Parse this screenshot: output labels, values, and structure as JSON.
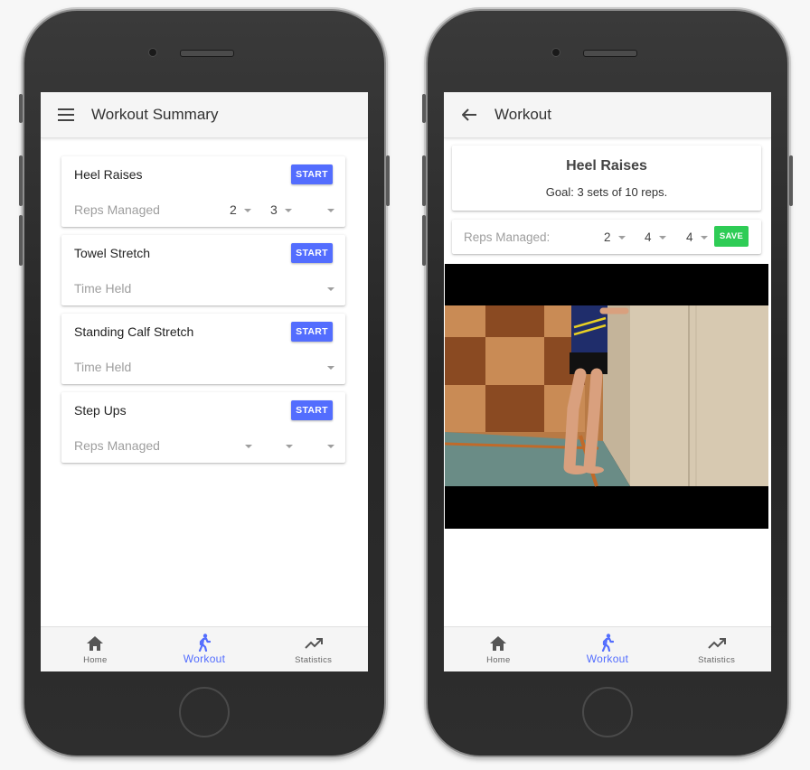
{
  "left_phone": {
    "appbar": {
      "title": "Workout Summary",
      "menu_icon": "menu-icon"
    },
    "exercises": [
      {
        "name": "Heel Raises",
        "button": "START",
        "measure": "Reps Managed",
        "values": [
          "2",
          "3",
          ""
        ]
      },
      {
        "name": "Towel Stretch",
        "button": "START",
        "measure": "Time Held",
        "values": [
          ""
        ]
      },
      {
        "name": "Standing Calf Stretch",
        "button": "START",
        "measure": "Time Held",
        "values": [
          ""
        ]
      },
      {
        "name": "Step Ups",
        "button": "START",
        "measure": "Reps Managed",
        "values": [
          "",
          "",
          ""
        ]
      }
    ],
    "bottom_nav": [
      {
        "label": "Home",
        "icon": "home-icon",
        "active": false
      },
      {
        "label": "Workout",
        "icon": "walking-person-icon",
        "active": true
      },
      {
        "label": "Statistics",
        "icon": "trending-up-icon",
        "active": false
      }
    ]
  },
  "right_phone": {
    "appbar": {
      "title": "Workout",
      "back_icon": "arrow-back-icon"
    },
    "exercise": {
      "title": "Heel Raises",
      "goal": "Goal: 3 sets of 10 reps."
    },
    "reps": {
      "label": "Reps Managed:",
      "values": [
        "2",
        "4",
        "4"
      ],
      "save_label": "SAVE"
    },
    "bottom_nav": [
      {
        "label": "Home",
        "icon": "home-icon",
        "active": false
      },
      {
        "label": "Workout",
        "icon": "walking-person-icon",
        "active": true
      },
      {
        "label": "Statistics",
        "icon": "trending-up-icon",
        "active": false
      }
    ]
  },
  "colors": {
    "accent": "#536dfe",
    "save": "#2ecc55",
    "appbar": "#f5f5f5",
    "muted_text": "#9e9e9e"
  }
}
